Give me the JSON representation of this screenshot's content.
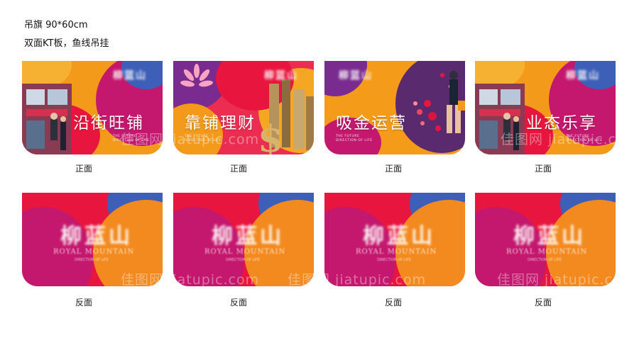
{
  "header": {
    "line1": "吊旗 90*60cm",
    "line2": "双面KT板，鱼线吊挂"
  },
  "logo": {
    "cn": "柳蓝山",
    "en": "ROYAL MOUNTAIN"
  },
  "tagline": {
    "line1": "THE FUTURE",
    "line2": "DIRECTION OF LIFE"
  },
  "fronts": [
    {
      "slogan": "沿街旺铺",
      "caption": "正面"
    },
    {
      "slogan": "靠铺理财",
      "caption": "正面"
    },
    {
      "slogan": "吸金运营",
      "caption": "正面"
    },
    {
      "slogan": "业态乐享",
      "caption": "正面"
    }
  ],
  "backs": [
    {
      "caption": "反面"
    },
    {
      "caption": "反面"
    },
    {
      "caption": "反面"
    },
    {
      "caption": "反面"
    }
  ],
  "watermark": "佳图网 jiatupic.com",
  "colors": {
    "red": "#e8163e",
    "orange": "#f39a1b",
    "magenta": "#c4186e",
    "blue": "#3d5fb8",
    "purple": "#7a2b8f"
  }
}
